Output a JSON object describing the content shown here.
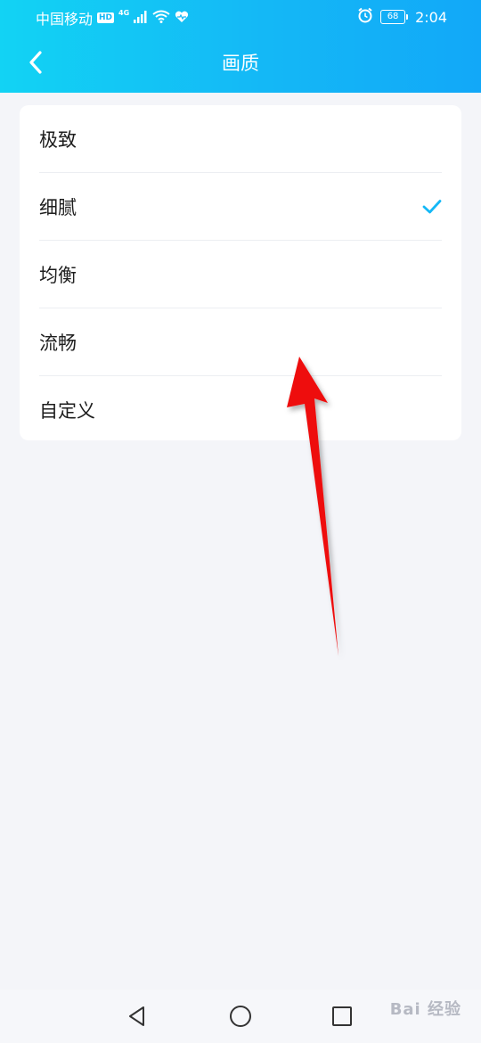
{
  "status_bar": {
    "carrier": "中国移动",
    "hd_badge": "HD",
    "network_type": "4G",
    "battery_level": "68",
    "time": "2:04",
    "icons": [
      "signal-icon",
      "wifi-icon",
      "heart-icon",
      "alarm-icon",
      "battery-icon"
    ]
  },
  "header": {
    "title": "画质",
    "back_icon": "chevron-left-icon"
  },
  "options": [
    {
      "label": "极致",
      "selected": false
    },
    {
      "label": "细腻",
      "selected": true
    },
    {
      "label": "均衡",
      "selected": false
    },
    {
      "label": "流畅",
      "selected": false
    },
    {
      "label": "自定义",
      "selected": false
    }
  ],
  "navigation": {
    "back_icon": "triangle-back-icon",
    "home_icon": "circle-home-icon",
    "recents_icon": "square-recents-icon"
  },
  "watermark": {
    "text": "Bai 经验"
  },
  "colors": {
    "header_start": "#12d3f4",
    "header_end": "#12a8f8",
    "background": "#f4f5f9",
    "accent": "#14b8f6",
    "arrow": "#ee1111"
  }
}
